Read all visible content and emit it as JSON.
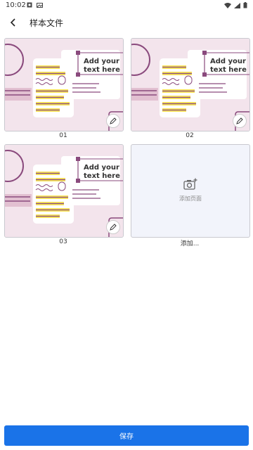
{
  "status": {
    "time": "10:02"
  },
  "app_bar": {
    "title": "样本文件"
  },
  "pages": [
    {
      "caption": "01",
      "thumb_text_line1": "Add your",
      "thumb_text_line2": "text here"
    },
    {
      "caption": "02",
      "thumb_text_line1": "Add your",
      "thumb_text_line2": "text here"
    },
    {
      "caption": "03",
      "thumb_text_line1": "Add your",
      "thumb_text_line2": "text here"
    }
  ],
  "add_page": {
    "label": "添加页面",
    "caption": "添加..."
  },
  "footer": {
    "save_label": "保存"
  },
  "colors": {
    "accent": "#1a73e8",
    "thumb_bg": "#f3e4ec",
    "highlight": "#f6e25a",
    "line_purple": "#8a4a7d"
  }
}
